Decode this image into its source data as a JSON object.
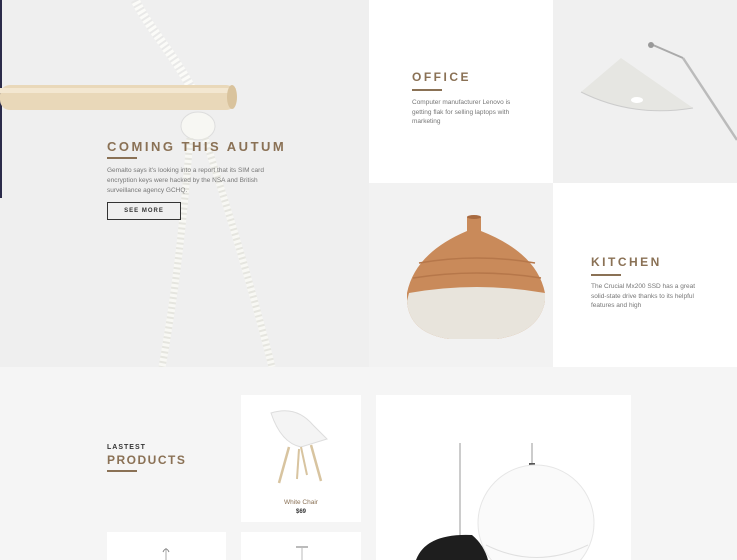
{
  "hero": {
    "title": "COMING THIS AUTUM",
    "text": "Gemalto says it's looking into a report that its SIM card encryption keys were hacked by the NSA and British surveillance agency GCHQ.",
    "button": "SEE MORE"
  },
  "office": {
    "title": "OFFICE",
    "text": "Computer manufacturer Lenovo is getting flak for selling laptops with marketing"
  },
  "kitchen": {
    "title": "KITCHEN",
    "text": "The Crucial Mx200 SSD has a great solid-state drive thanks to its helpful features and high"
  },
  "products": {
    "kicker": "LASTEST",
    "title": "PRODUCTS",
    "items": [
      {
        "name": "White Chair",
        "price": "$69"
      }
    ]
  },
  "colors": {
    "accent": "#8a7155",
    "dark": "#333333"
  }
}
